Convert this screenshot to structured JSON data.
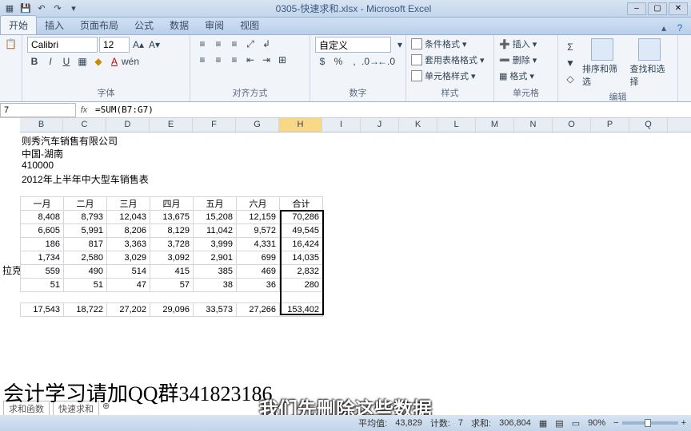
{
  "title": "0305-快速求和.xlsx - Microsoft Excel",
  "tabs": [
    "开始",
    "插入",
    "页面布局",
    "公式",
    "数据",
    "审阅",
    "视图"
  ],
  "font": {
    "name": "Calibri",
    "size": "12",
    "group": "字体"
  },
  "align": {
    "group": "对齐方式"
  },
  "number": {
    "format": "自定义",
    "group": "数字"
  },
  "styles": {
    "cond": "条件格式",
    "table": "套用表格格式",
    "cell": "单元格样式",
    "group": "样式"
  },
  "cells_group": {
    "insert": "插入",
    "delete": "删除",
    "format": "格式",
    "group": "单元格"
  },
  "editing": {
    "sort": "排序和筛选",
    "find": "查找和选择",
    "group": "编辑"
  },
  "namebox": "7",
  "formula": "=SUM(B7:G7)",
  "text1": "则秀汽车销售有限公司",
  "text2": "中国-湖南",
  "text3": "410000",
  "text4": "2012年上半年中大型车销售表",
  "rowlabel": "拉克",
  "headers": [
    "一月",
    "二月",
    "三月",
    "四月",
    "五月",
    "六月",
    "合计"
  ],
  "rows": [
    [
      8408,
      8793,
      12043,
      13675,
      15208,
      12159,
      70286
    ],
    [
      6605,
      5991,
      8206,
      8129,
      11042,
      9572,
      49545
    ],
    [
      186,
      817,
      3363,
      3728,
      3999,
      4331,
      16424
    ],
    [
      1734,
      2580,
      3029,
      3092,
      2901,
      699,
      14035
    ],
    [
      559,
      490,
      514,
      415,
      385,
      469,
      2832
    ],
    [
      51,
      51,
      47,
      57,
      38,
      36,
      280
    ]
  ],
  "totals": [
    17543,
    18722,
    27202,
    29096,
    33573,
    27266,
    "153,402"
  ],
  "sheets": [
    "求和函数",
    "快速求和"
  ],
  "status": {
    "avg_label": "平均值:",
    "avg": "43,829",
    "count_label": "计数:",
    "count": "7",
    "sum_label": "求和:",
    "sum": "306,804",
    "zoom": "90%"
  },
  "watermark": "会计学习请加QQ群341823186",
  "subtitle": "我们先删除这些数据",
  "colheads": [
    "B",
    "C",
    "D",
    "E",
    "F",
    "G",
    "H",
    "I",
    "J",
    "K",
    "L",
    "M",
    "N",
    "O",
    "P",
    "Q"
  ]
}
